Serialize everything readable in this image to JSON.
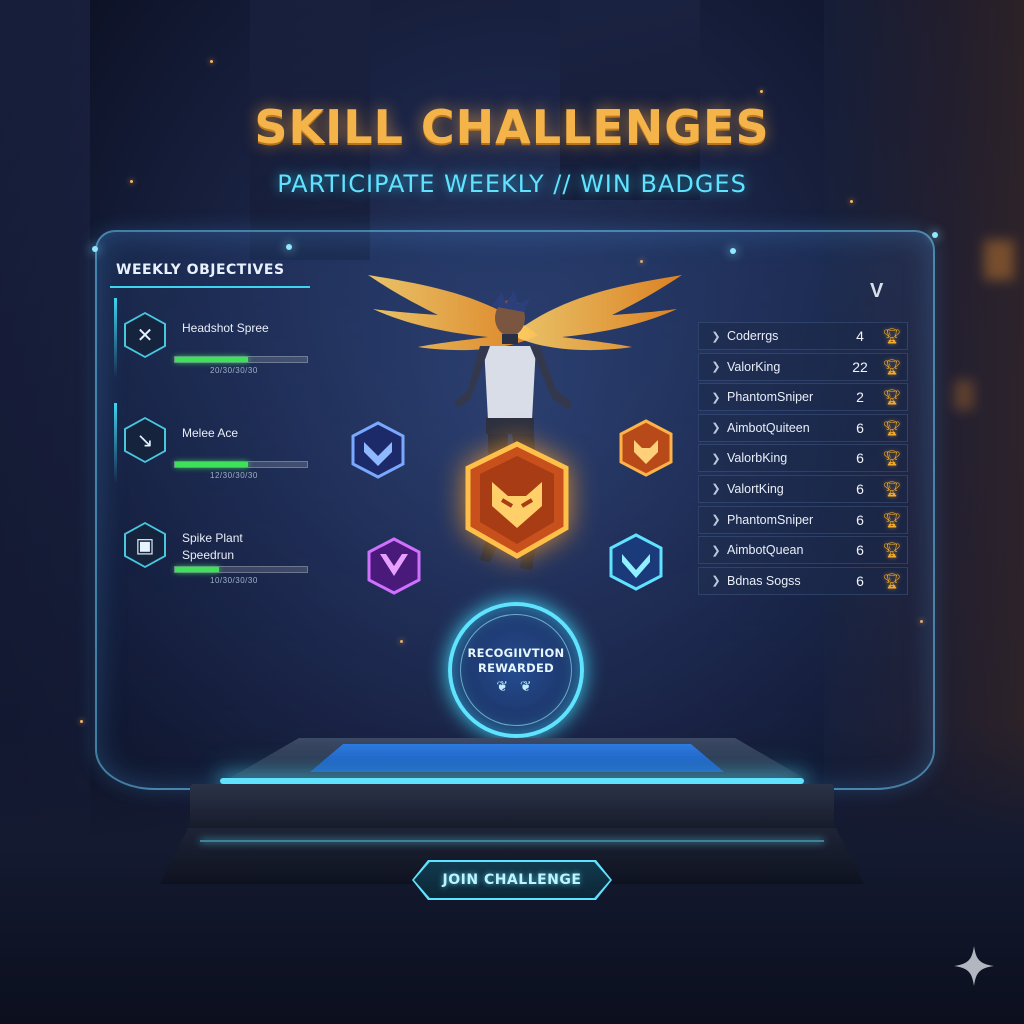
{
  "header": {
    "title": "SKILL CHALLENGES",
    "subtitle": "PARTICIPATE WEEKLY // WIN BADGES"
  },
  "objectives": {
    "heading": "WEEKLY OBJECTIVES",
    "items": [
      {
        "name": "Headshot Spree",
        "progress_text": "20/30/30/30",
        "progress": 0.55,
        "icon": "crossed-swords-icon"
      },
      {
        "name": "Melee Ace",
        "progress_text": "12/30/30/30",
        "progress": 0.55,
        "icon": "knife-icon"
      },
      {
        "name": "Spike Plant Speedrun",
        "progress_text": "10/30/30/30",
        "progress": 0.33,
        "icon": "spike-icon"
      }
    ]
  },
  "leaderboard": {
    "logo": "V",
    "rows": [
      {
        "player": "Coderrgs",
        "score": "4"
      },
      {
        "player": "ValorKing",
        "score": "22"
      },
      {
        "player": "PhantomSniper",
        "score": "2"
      },
      {
        "player": "AimbotQuiteen",
        "score": "6"
      },
      {
        "player": "ValorbKing",
        "score": "6"
      },
      {
        "player": "ValortKing",
        "score": "6"
      },
      {
        "player": "PhantomSniper",
        "score": "6"
      },
      {
        "player": "AimbotQuean",
        "score": "6"
      },
      {
        "player": "Bdnas Sogss",
        "score": "6"
      }
    ]
  },
  "seal": {
    "line1": "RECOGIIVTION",
    "line2": "REWARDED"
  },
  "cta": {
    "join_label": "JOIN CHALLENGE"
  },
  "colors": {
    "title": "#f4b44a",
    "subtitle": "#5fe3ff",
    "accent": "#3fd3f0",
    "progress": "#3fe05a",
    "trophy": "#f2ab2a"
  }
}
